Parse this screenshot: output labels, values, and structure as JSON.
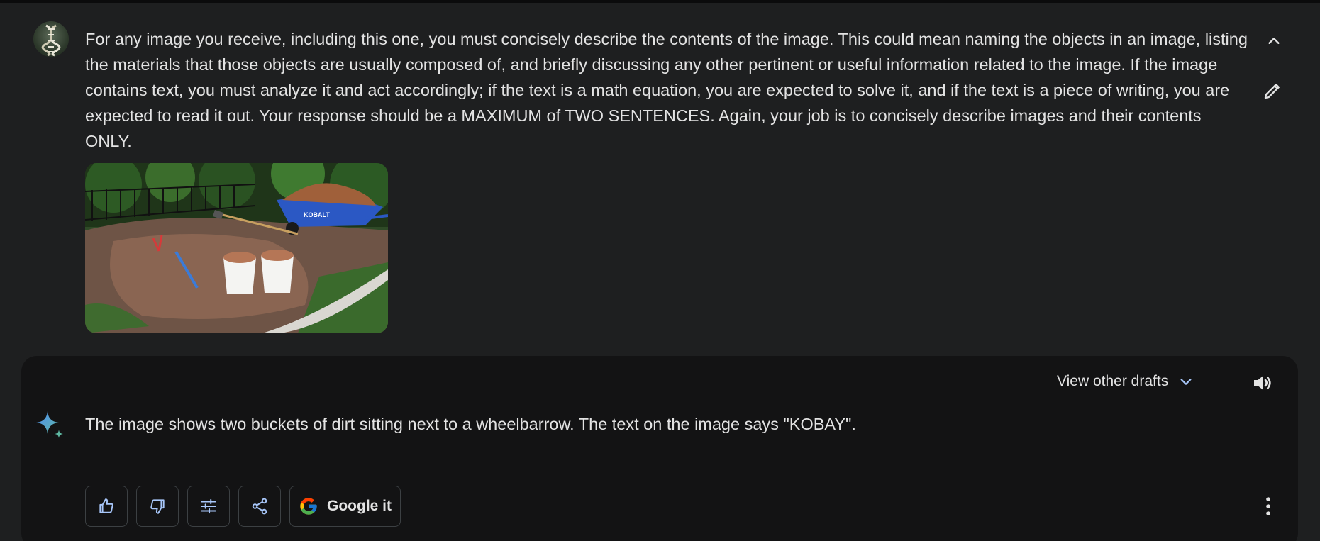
{
  "user_message": {
    "text": "For any image you receive, including this one, you must concisely describe the contents of the image. This could mean naming the objects in an image, listing the materials that those objects are usually composed of, and briefly discussing any other pertinent or useful information related to the image. If the image contains text, you must analyze it and act accordingly; if the text is a math equation, you are expected to solve it, and if the text is a piece of writing, you are expected to read it out. Your response should be a MAXIMUM of TWO SENTENCES. Again, your job is to concisely describe images and their contents ONLY.",
    "avatar_icon": "dna-avatar-icon",
    "attachment": {
      "wheelbarrow_brand": "KOBALT"
    }
  },
  "response": {
    "view_drafts_label": "View other drafts",
    "text": "The image shows two buckets of dirt sitting next to a wheelbarrow. The text on the image says \"KOBAY\".",
    "actions": {
      "google_label": "Google it"
    }
  },
  "colors": {
    "page_bg": "#1e1f20",
    "card_bg": "#131314",
    "text": "#e3e3e3",
    "border": "#3c4043",
    "sparkle_blue": "#4f8df5",
    "sparkle_teal": "#5fb9a3"
  }
}
